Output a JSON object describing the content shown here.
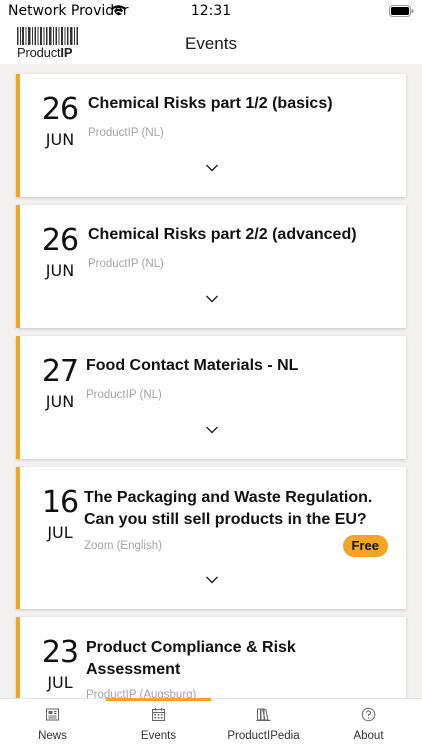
{
  "status_bar": {
    "carrier": "Network Provider",
    "time": "12:31"
  },
  "header": {
    "logo_text_light": "Product",
    "logo_text_bold": "IP",
    "title": "Events"
  },
  "events": [
    {
      "day": "26",
      "month": "JUN",
      "title": "Chemical Risks part 1/2 (basics)",
      "location": "ProductIP (NL)"
    },
    {
      "day": "26",
      "month": "JUN",
      "title": "Chemical Risks part 2/2 (advanced)",
      "location": "ProductIP (NL)"
    },
    {
      "day": "27",
      "month": "JUN",
      "title": "Food Contact Materials - NL",
      "location": "ProductIP (NL)"
    },
    {
      "day": "16",
      "month": "JUL",
      "title": "The Packaging and Waste Regulation. Can you still sell products in the EU?",
      "location": "Zoom (English)",
      "badge": "Free"
    },
    {
      "day": "23",
      "month": "JUL",
      "title": "Product Compliance & Risk Assessment",
      "location": "ProductIP (Augsburg)"
    }
  ],
  "tabs": [
    {
      "label": "News",
      "icon": "newspaper-icon"
    },
    {
      "label": "Events",
      "icon": "calendar-icon",
      "active": true
    },
    {
      "label": "ProductIPedia",
      "icon": "books-icon"
    },
    {
      "label": "About",
      "icon": "question-circle-icon"
    }
  ],
  "colors": {
    "accent": "#f0a623",
    "background": "#f2f1ef"
  }
}
